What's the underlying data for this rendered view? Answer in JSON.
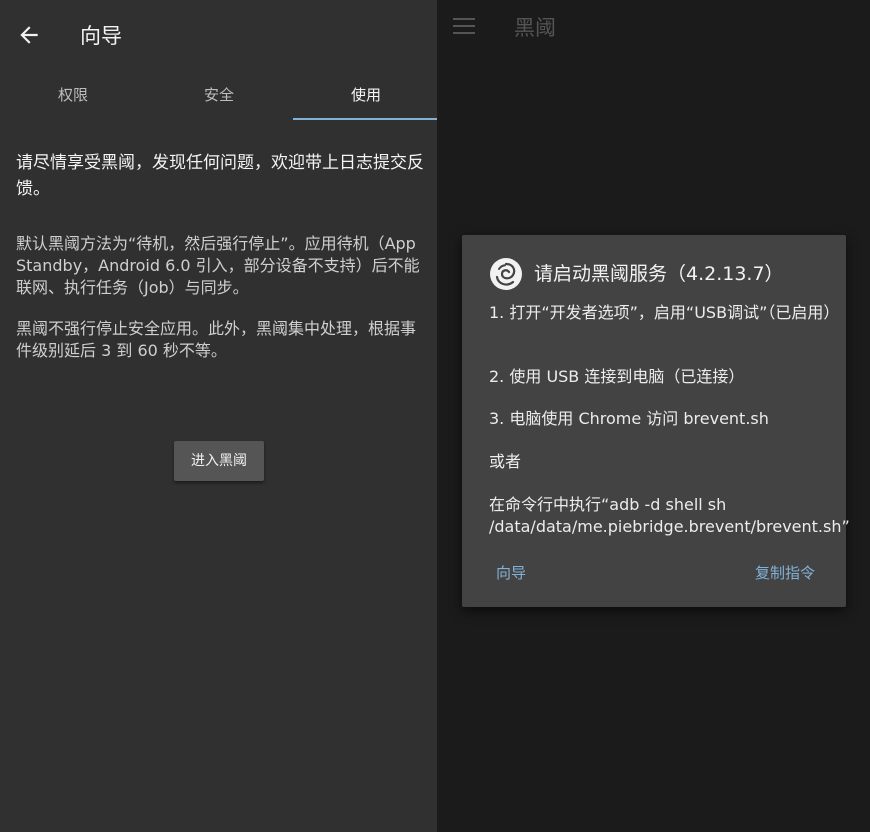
{
  "left": {
    "title": "向导",
    "tabs": [
      {
        "label": "权限",
        "active": false
      },
      {
        "label": "安全",
        "active": false
      },
      {
        "label": "使用",
        "active": true
      }
    ],
    "intro": "请尽情享受黑阈，发现任何问题，欢迎带上日志提交反馈。",
    "paragraphs": [
      "默认黑阈方法为“待机，然后强行停止”。应用待机（App Standby，Android 6.0 引入，部分设备不支持）后不能联网、执行任务（Job）与同步。",
      "黑阈不强行停止安全应用。此外，黑阈集中处理，根据事件级别延后 3 到 60 秒不等。"
    ],
    "enter_button": "进入黑阈"
  },
  "right": {
    "title": "黑阈",
    "dialog": {
      "title": "请启动黑阈服务（4.2.13.7）",
      "step1": "1. 打开“开发者选项”，启用“USB调试”（已启用）",
      "step2": "2. 使用 USB 连接到电脑（已连接）",
      "step3": "3. 电脑使用 Chrome 访问 brevent.sh",
      "or": "或者",
      "command": "在命令行中执行“adb -d shell sh /data/data/me.piebridge.brevent/brevent.sh”",
      "action_guide": "向导",
      "action_copy": "复制指令"
    }
  },
  "colors": {
    "accent": "#82b1d6",
    "left_bg": "#303030",
    "right_bg": "#1b1b1b",
    "dialog_bg": "#434343"
  },
  "icons": [
    "back-arrow-icon",
    "menu-icon",
    "brevent-logo-icon"
  ]
}
